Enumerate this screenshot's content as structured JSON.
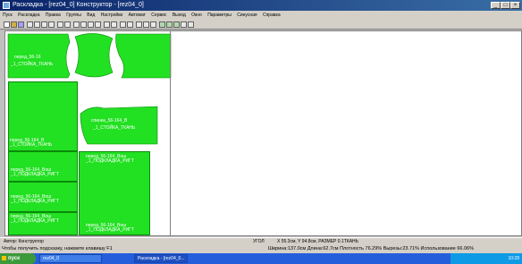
{
  "window": {
    "title": "Раскладка - [rez04_0] Конструктор - [rez04_0]"
  },
  "menu": [
    "Пуск",
    "Раскладка",
    "Правка",
    "Группы",
    "Вид",
    "Настройки",
    "Автомат",
    "Сервис",
    "Выход",
    "Окно",
    "Параметры",
    "Синусная",
    "Справка"
  ],
  "pieces": {
    "p1": {
      "l1": "перед_56-1б",
      "l2": "_1_СТОЙКА_ТКАНЬ"
    },
    "p2": {
      "l1": "спинка_56-164_В",
      "l2": "_1_СТОЙКА_ТКАНЬ"
    },
    "p3": {
      "l1": "перед_56-164_В",
      "l2": "_1_СТОЙКА_ТКАНЬ"
    },
    "p4": {
      "l1": "перед_56-164_Вош",
      "l2": "_1_ПОДКЛАДКА_РИГТ"
    },
    "p5": {
      "l1": "перед_56-164_Вош",
      "l2": "_1_ПОДКЛАДКА_РИГТ"
    },
    "p6": {
      "l1": "перед_56-164_Вош",
      "l2": "_1_ПОДКЛАДКА_РИГТ"
    },
    "p7": {
      "l1": "перед_56-164_Вош",
      "l2": "_1_ПОДКЛАДКА_РИГТ"
    },
    "p8": {
      "l1": "перед_56-164_Вош",
      "l2": "_1_ПОДКЛАДКА_РИГТ"
    }
  },
  "status": {
    "left": "Автор: Конструктор",
    "mid": "УГОЛ",
    "coords": "X 55.3см, Y 94.8см, РАЗМЕР 0.1ТКАНЬ"
  },
  "hint": {
    "text": "Чтобы получить подсказку, нажмите клавишу F1",
    "stats": "Ширина:137.0см Длина:62.7см Плотность 76.29% Вырезы:23.71% Использование 66.06%"
  },
  "taskbar": {
    "start": "пуск",
    "tasks": [
      "rez04_0",
      "Раскладка - [rez04_0..."
    ],
    "clock": "10:28"
  }
}
